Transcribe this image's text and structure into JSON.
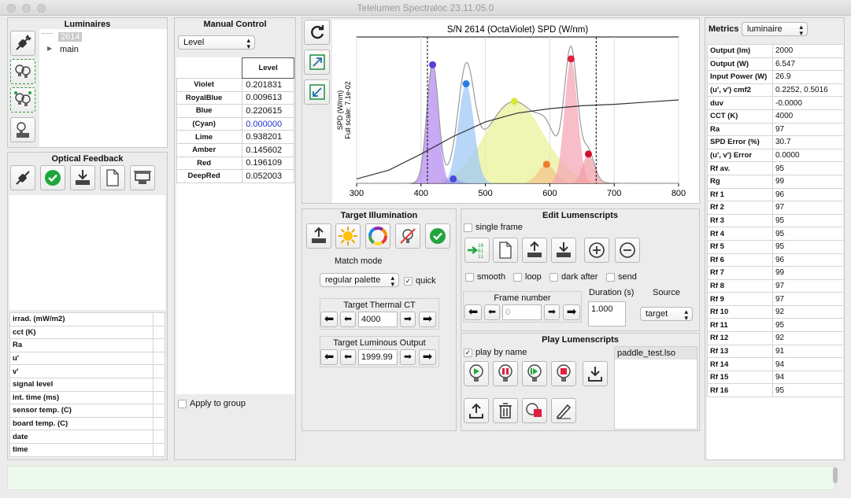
{
  "window": {
    "title": "Telelumen Spectraloc 23.11.05.0"
  },
  "luminaires": {
    "title": "Luminaires",
    "tree": [
      {
        "label": "2614",
        "selected": true
      },
      {
        "label": "main",
        "selected": false
      }
    ]
  },
  "optical": {
    "title": "Optical Feedback",
    "rows": [
      {
        "label": "irrad. (mW/m2)",
        "value": ""
      },
      {
        "label": "cct (K)",
        "value": ""
      },
      {
        "label": "Ra",
        "value": ""
      },
      {
        "label": "u'",
        "value": ""
      },
      {
        "label": "v'",
        "value": ""
      },
      {
        "label": "signal level",
        "value": ""
      },
      {
        "label": "int. time (ms)",
        "value": ""
      },
      {
        "label": "sensor temp. (C)",
        "value": ""
      },
      {
        "label": "board temp. (C)",
        "value": ""
      },
      {
        "label": "date",
        "value": ""
      },
      {
        "label": "time",
        "value": ""
      }
    ]
  },
  "manual": {
    "title": "Manual Control",
    "mode": "Level",
    "column": "Level",
    "rows": [
      {
        "name": "Violet",
        "value": "0.201831"
      },
      {
        "name": "RoyalBlue",
        "value": "0.009613"
      },
      {
        "name": "Blue",
        "value": "0.220615"
      },
      {
        "name": "(Cyan)",
        "value": "0.000000"
      },
      {
        "name": "Lime",
        "value": "0.938201"
      },
      {
        "name": "Amber",
        "value": "0.145602"
      },
      {
        "name": "Red",
        "value": "0.196109"
      },
      {
        "name": "DeepRed",
        "value": "0.052003"
      }
    ],
    "apply_group": "Apply to group"
  },
  "chart_data": {
    "type": "line",
    "title": "S/N 2614 (OctaViolet) SPD (W/nm)",
    "ylabel": "SPD (W/nm)",
    "ylabel2": "Full scale: 7.1e-02",
    "xlim": [
      300,
      800
    ],
    "ylim": [
      0,
      1
    ],
    "xticks": [
      "300",
      "400",
      "500",
      "600",
      "700",
      "800"
    ],
    "markers": [
      410,
      672
    ],
    "grid": true,
    "channels": [
      {
        "name": "Violet",
        "peak": 418,
        "height": 0.81,
        "width": 9,
        "color": "#b58cf0",
        "dot": "#5a3cd8"
      },
      {
        "name": "RoyalBlue",
        "peak": 450,
        "height": 0.03,
        "width": 10,
        "color": "#8fa0f0",
        "dot": "#4b4bd8"
      },
      {
        "name": "Blue",
        "peak": 470,
        "height": 0.68,
        "width": 12,
        "color": "#9fc8f5",
        "dot": "#2a7ee0"
      },
      {
        "name": "Lime",
        "peak": 545,
        "height": 0.56,
        "width": 45,
        "color": "#e9f29a",
        "dot": "#d8e838"
      },
      {
        "name": "Amber",
        "peak": 595,
        "height": 0.13,
        "width": 13,
        "color": "#f6c48c",
        "dot": "#f07a2a"
      },
      {
        "name": "Red",
        "peak": 633,
        "height": 0.85,
        "width": 10,
        "color": "#f4a7b5",
        "dot": "#e02040"
      },
      {
        "name": "DeepRed",
        "peak": 660,
        "height": 0.2,
        "width": 9,
        "color": "#f2a0a8",
        "dot": "#d01030"
      }
    ],
    "blackbody": {
      "x": [
        300,
        350,
        400,
        450,
        500,
        550,
        600,
        650,
        700,
        750,
        800
      ],
      "y": [
        0.03,
        0.09,
        0.2,
        0.32,
        0.42,
        0.48,
        0.51,
        0.53,
        0.54,
        0.555,
        0.57
      ]
    }
  },
  "target": {
    "title": "Target Illumination",
    "match_mode_label": "Match mode",
    "match_mode": "regular palette",
    "quick": "quick",
    "thermal_title": "Target Thermal CT",
    "thermal_value": "4000",
    "lum_title": "Target Luminous Output",
    "lum_value": "1999.99"
  },
  "edit": {
    "title": "Edit Lumenscripts",
    "single_frame": "single frame",
    "smooth": "smooth",
    "loop": "loop",
    "dark_after": "dark after",
    "send": "send",
    "frame_label": "Frame number",
    "frame_value": "0",
    "duration_label": "Duration (s)",
    "duration_value": "1.000",
    "source_label": "Source",
    "source_value": "target"
  },
  "play": {
    "title": "Play Lumenscripts",
    "play_by_name": "play by name",
    "files": [
      "paddle_test.lso"
    ]
  },
  "metrics": {
    "title": "Metrics",
    "mode": "luminaire",
    "rows": [
      {
        "label": "Output (lm)",
        "value": "2000"
      },
      {
        "label": "Output (W)",
        "value": "6.547"
      },
      {
        "label": "Input Power (W)",
        "value": "26.9"
      },
      {
        "label": "(u', v') cmf2",
        "value": "0.2252, 0.5016"
      },
      {
        "label": "duv",
        "value": "-0.0000"
      },
      {
        "label": "CCT (K)",
        "value": "4000"
      },
      {
        "label": "Ra",
        "value": "97"
      },
      {
        "label": "SPD Error (%)",
        "value": "30.7"
      },
      {
        "label": "(u', v') Error",
        "value": "0.0000"
      },
      {
        "label": "Rf av.",
        "value": "95"
      },
      {
        "label": "Rg",
        "value": "99"
      },
      {
        "label": "Rf 1",
        "value": "96"
      },
      {
        "label": "Rf 2",
        "value": "97"
      },
      {
        "label": "Rf 3",
        "value": "95"
      },
      {
        "label": "Rf 4",
        "value": "95"
      },
      {
        "label": "Rf 5",
        "value": "95"
      },
      {
        "label": "Rf 6",
        "value": "96"
      },
      {
        "label": "Rf 7",
        "value": "99"
      },
      {
        "label": "Rf 8",
        "value": "97"
      },
      {
        "label": "Rf 9",
        "value": "97"
      },
      {
        "label": "Rf 10",
        "value": "92"
      },
      {
        "label": "Rf 11",
        "value": "95"
      },
      {
        "label": "Rf 12",
        "value": "92"
      },
      {
        "label": "Rf 13",
        "value": "91"
      },
      {
        "label": "Rf 14",
        "value": "94"
      },
      {
        "label": "Rf 15",
        "value": "94"
      },
      {
        "label": "Rf 16",
        "value": "95"
      }
    ]
  },
  "status": {
    "text": ""
  }
}
